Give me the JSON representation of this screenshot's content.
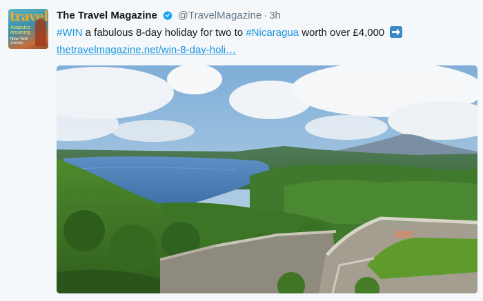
{
  "tweet": {
    "display_name": "The Travel Magazine",
    "handle": "@TravelMagazine",
    "separator": "·",
    "time": "3h",
    "text": {
      "hashtag_win": "#WIN",
      "middle": " a fabulous 8-day holiday for two to ",
      "hashtag_place": "#Nicaragua",
      "end": " worth over £4,000"
    },
    "link": "thetravelmagazine.net/win-8-day-holi…"
  },
  "avatar": {
    "logo": "travel",
    "line1": "Acapulco",
    "line2": "dreaming",
    "line3": "New York",
    "line4": "Azores"
  },
  "icons": {
    "verified": "verified-badge-icon",
    "arrow": "right-arrow-emoji-icon"
  },
  "colors": {
    "link": "#1b95e0",
    "name": "#14171a",
    "meta": "#657786",
    "background": "#f5f8fa",
    "verified": "#1da1f2"
  }
}
